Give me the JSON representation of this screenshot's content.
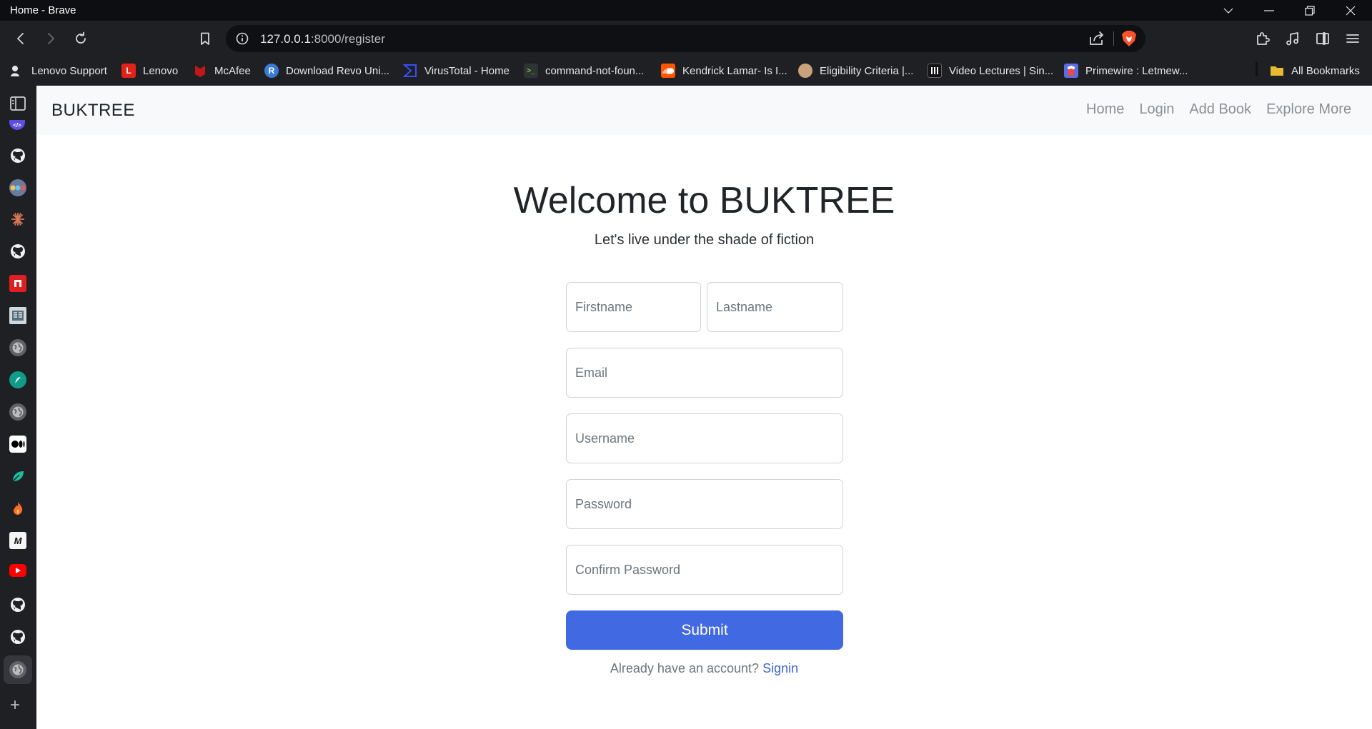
{
  "window": {
    "title": "Home - Brave"
  },
  "toolbar": {
    "url_host": "127.0.0.1",
    "url_path": ":8000/register"
  },
  "bookmarks": [
    {
      "label": "Lenovo Support",
      "icon": "lenovo-support-icon",
      "color": "#ffffff"
    },
    {
      "label": "Lenovo",
      "icon": "lenovo-icon",
      "color": "#e2231a"
    },
    {
      "label": "McAfee",
      "icon": "mcafee-icon",
      "color": "#c01818"
    },
    {
      "label": "Download Revo Uni...",
      "icon": "revo-icon",
      "color": "#3a7bd5"
    },
    {
      "label": "VirusTotal - Home",
      "icon": "virustotal-icon",
      "color": "#394eff"
    },
    {
      "label": "command-not-foun...",
      "icon": "terminal-icon",
      "color": "#2e3436"
    },
    {
      "label": "Kendrick Lamar- Is I...",
      "icon": "soundcloud-icon",
      "color": "#ff5500"
    },
    {
      "label": "Eligibility Criteria |...",
      "icon": "eligibility-icon",
      "color": "#8d6e63"
    },
    {
      "label": "Video Lectures | Sin...",
      "icon": "video-lectures-icon",
      "color": "#111111"
    },
    {
      "label": "Primewire : Letmew...",
      "icon": "primewire-icon",
      "color": "#5b6ee1"
    },
    {
      "label": "All Bookmarks",
      "icon": "folder-icon",
      "color": "#e8b931"
    }
  ],
  "navbar": {
    "brand": "BUKTREE",
    "links": [
      "Home",
      "Login",
      "Add Book",
      "Explore More"
    ]
  },
  "hero": {
    "title": "Welcome to BUKTREE",
    "subtitle": "Let's live under the shade of fiction"
  },
  "form": {
    "firstname_placeholder": "Firstname",
    "lastname_placeholder": "Lastname",
    "email_placeholder": "Email",
    "username_placeholder": "Username",
    "password_placeholder": "Password",
    "confirm_password_placeholder": "Confirm Password",
    "submit_label": "Submit",
    "signin_prompt": "Already have an account?",
    "signin_link": "Signin",
    "accent_color": "#4169e1"
  }
}
